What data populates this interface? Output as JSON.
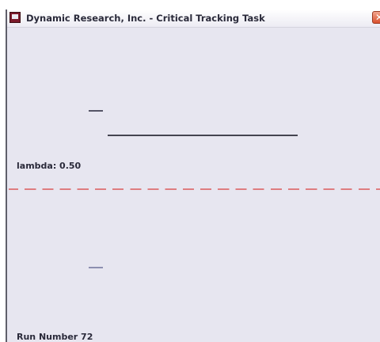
{
  "window": {
    "title": "Dynamic Research, Inc. - Critical Tracking Task",
    "close_glyph": "✕"
  },
  "display": {
    "lambda_text": "lambda: 0.50",
    "run_number_text": "Run Number 72"
  },
  "colors": {
    "divider": "#de7d80",
    "close_button": "#d9502d"
  },
  "icons": {
    "app": "app-window-icon",
    "close": "close-icon"
  }
}
